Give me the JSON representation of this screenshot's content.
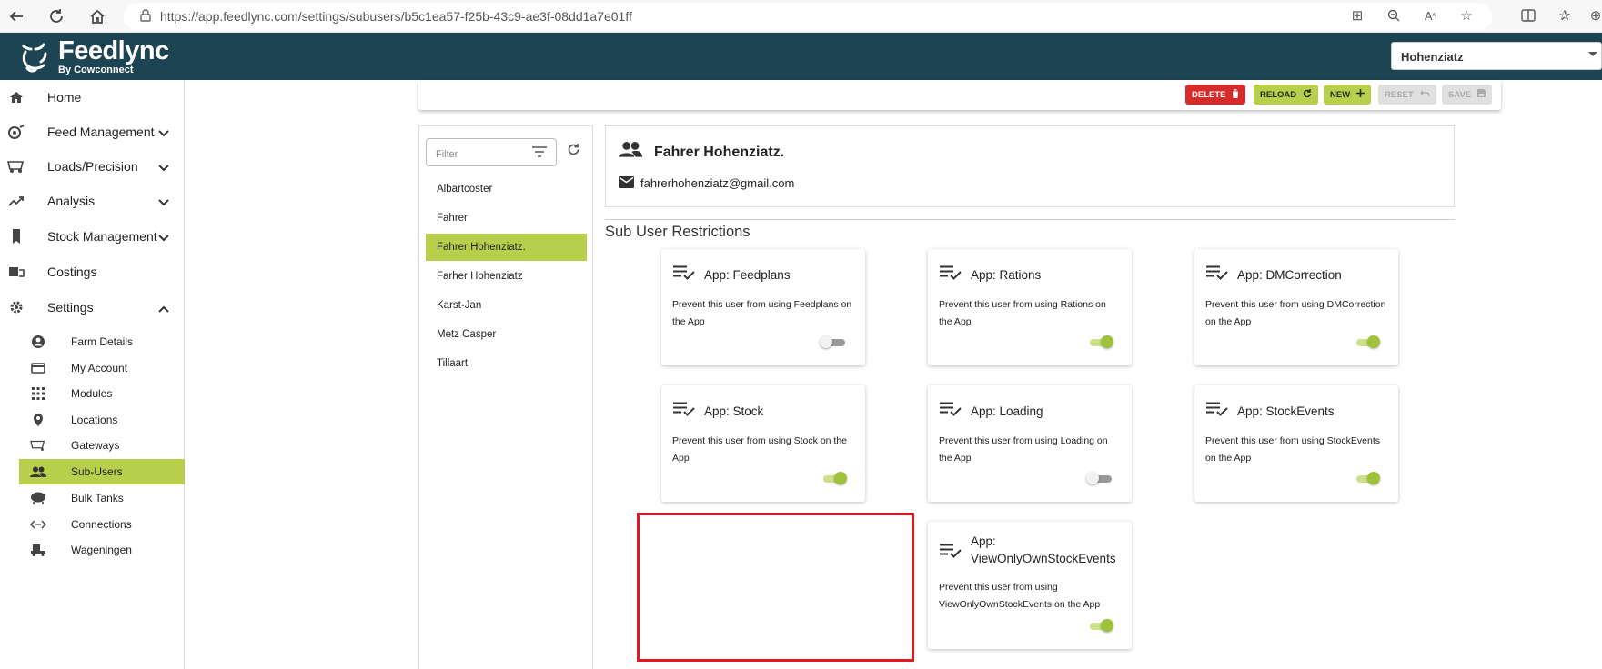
{
  "browser": {
    "url": "https://app.feedlync.com/settings/subusers/b5c1ea57-f25b-43c9-ae3f-08dd1a7e01ff"
  },
  "header": {
    "brand": "Feedlync",
    "brand_sub": "By Cowconnect",
    "farm_selected": "Hohenziatz"
  },
  "sidebar": {
    "items": [
      {
        "label": "Home",
        "icon": "home-icon"
      },
      {
        "label": "Feed Management",
        "icon": "feed-icon",
        "expandable": true
      },
      {
        "label": "Loads/Precision",
        "icon": "wagon-icon",
        "expandable": true
      },
      {
        "label": "Analysis",
        "icon": "trend-icon",
        "expandable": true
      },
      {
        "label": "Stock Management",
        "icon": "silo-icon",
        "expandable": true
      },
      {
        "label": "Costings",
        "icon": "costings-icon"
      },
      {
        "label": "Settings",
        "icon": "gear-icon",
        "expanded": true
      }
    ],
    "settings_items": [
      {
        "label": "Farm Details",
        "icon": "account-circle-icon"
      },
      {
        "label": "My Account",
        "icon": "credit-card-icon"
      },
      {
        "label": "Modules",
        "icon": "grid-icon"
      },
      {
        "label": "Locations",
        "icon": "location-pin-icon"
      },
      {
        "label": "Gateways",
        "icon": "gateway-icon"
      },
      {
        "label": "Sub-Users",
        "icon": "people-icon",
        "active": true
      },
      {
        "label": "Bulk Tanks",
        "icon": "tank-icon"
      },
      {
        "label": "Connections",
        "icon": "code-icon"
      },
      {
        "label": "Wageningen",
        "icon": "wageningen-icon"
      }
    ]
  },
  "toolbar": {
    "delete": "DELETE",
    "reload": "RELOAD",
    "new": "NEW",
    "reset": "RESET",
    "save": "SAVE"
  },
  "list": {
    "filter_placeholder": "Filter",
    "users": [
      {
        "name": "Albartcoster"
      },
      {
        "name": "Fahrer"
      },
      {
        "name": "Fahrer Hohenziatz.",
        "active": true
      },
      {
        "name": "Farher Hohenziatz"
      },
      {
        "name": "Karst-Jan"
      },
      {
        "name": "Metz Casper"
      },
      {
        "name": "Tillaart"
      }
    ]
  },
  "detail": {
    "name": "Fahrer Hohenziatz.",
    "email": "fahrerhohenziatz@gmail.com"
  },
  "restrictions": {
    "title": "Sub User Restrictions",
    "cards": [
      {
        "title": "App: Feedplans",
        "desc": "Prevent this user from using Feedplans on the App",
        "enabled": false
      },
      {
        "title": "App: Rations",
        "desc": "Prevent this user from using Rations on the App",
        "enabled": true
      },
      {
        "title": "App: DMCorrection",
        "desc": "Prevent this user from using DMCorrection on the App",
        "enabled": true
      },
      {
        "title": "App: Stock",
        "desc": "Prevent this user from using Stock on the App",
        "enabled": true
      },
      {
        "title": "App: Loading",
        "desc": "Prevent this user from using Loading on the App",
        "enabled": false
      },
      {
        "title": "App: StockEvents",
        "desc": "Prevent this user from using StockEvents on the App",
        "enabled": true
      },
      {
        "title": "App: ViewOnlyOwnStockEvents",
        "desc": "Prevent this user from using ViewOnlyOwnStockEvents on the App",
        "enabled": true
      }
    ]
  },
  "colors": {
    "header_bg": "#1d4452",
    "accent": "#b7cf4b",
    "danger": "#d72a2a",
    "highlight_box": "#e2161f"
  }
}
